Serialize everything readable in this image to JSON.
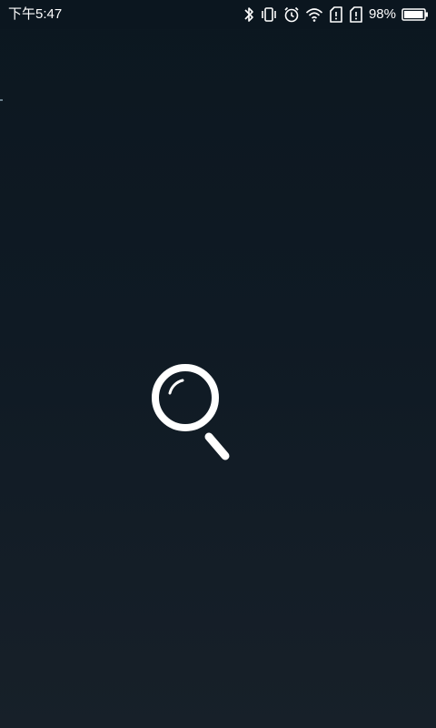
{
  "status_bar": {
    "time": "下午5:47",
    "battery_percent": "98%",
    "battery_level": 0.98,
    "icons": [
      "bluetooth-icon",
      "vibrate-icon",
      "alarm-icon",
      "wifi-icon",
      "sim-card-icon",
      "sim-card-icon",
      "battery-icon"
    ]
  },
  "main": {
    "center_icon": "search-icon"
  },
  "colors": {
    "background_top": "#0c1720",
    "background_bottom": "#172029",
    "icon_color": "#ffffff"
  }
}
